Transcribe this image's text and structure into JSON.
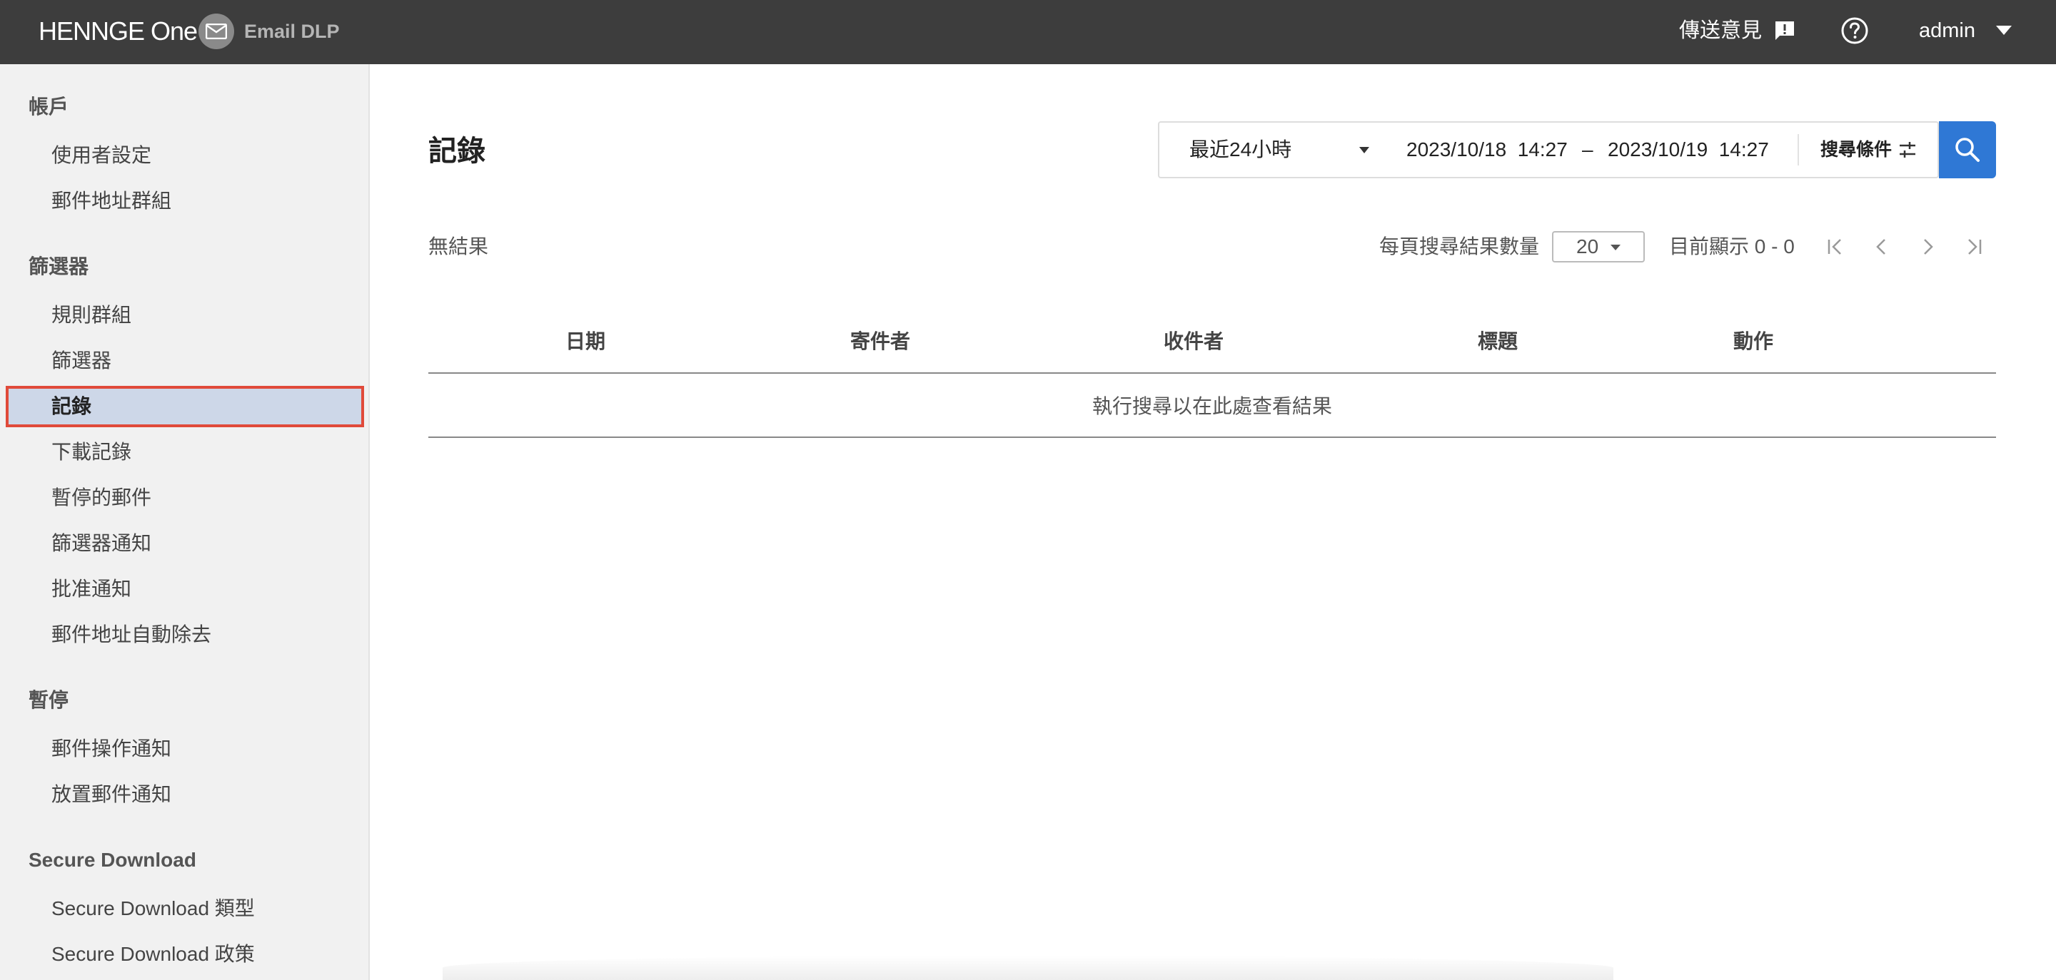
{
  "header": {
    "brand": "HENNGE One",
    "product": "Email DLP",
    "feedback_label": "傳送意見",
    "user_label": "admin",
    "icons": [
      "mail-icon",
      "feedback-icon",
      "help-icon",
      "caret-down-icon"
    ]
  },
  "sidebar": {
    "sections": [
      {
        "title": "帳戶",
        "items": [
          "使用者設定",
          "郵件地址群組"
        ]
      },
      {
        "title": "篩選器",
        "items": [
          "規則群組",
          "篩選器",
          "記錄",
          "下載記錄",
          "暫停的郵件",
          "篩選器通知",
          "批准通知",
          "郵件地址自動除去"
        ]
      },
      {
        "title": "暫停",
        "items": [
          "郵件操作通知",
          "放置郵件通知"
        ]
      },
      {
        "title": "Secure Download",
        "items": [
          "Secure Download 類型",
          "Secure Download 政策"
        ]
      }
    ],
    "active_item": "記錄"
  },
  "main": {
    "title": "記錄",
    "search": {
      "range": "最近24小時",
      "from_date": "2023/10/18",
      "from_time": "14:27",
      "separator": "–",
      "to_date": "2023/10/19",
      "to_time": "14:27",
      "conditions_label": "搜尋條件"
    },
    "results": {
      "no_result": "無結果",
      "per_page_label": "每頁搜尋結果數量",
      "per_page_value": "20",
      "showing": "目前顯示 0 - 0"
    },
    "table": {
      "columns": [
        "日期",
        "寄件者",
        "收件者",
        "標題",
        "動作"
      ],
      "empty_message": "執行搜尋以在此處查看結果"
    }
  },
  "colors": {
    "topbar": "#3d3d3d",
    "sidebar": "#f1f1f1",
    "active_bg": "#cdd7e8",
    "active_border": "#e04a3a",
    "accent": "#2f78d5"
  }
}
